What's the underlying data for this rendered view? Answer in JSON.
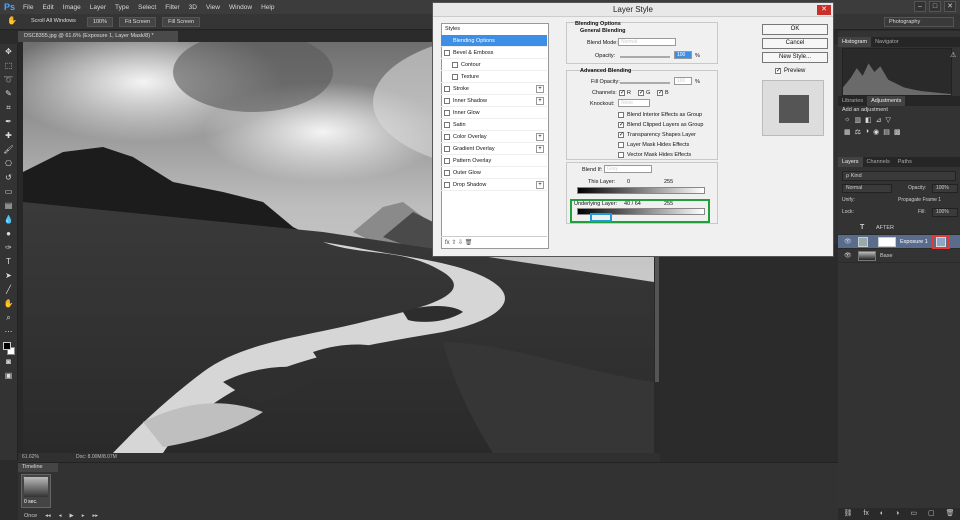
{
  "app": {
    "logo": "Ps",
    "menu": [
      "File",
      "Edit",
      "Image",
      "Layer",
      "Type",
      "Select",
      "Filter",
      "3D",
      "View",
      "Window",
      "Help"
    ],
    "window_controls": [
      "–",
      "□",
      "✕"
    ]
  },
  "options_bar": {
    "scroll_all": "Scroll All Windows",
    "zoom_100": "100%",
    "fit_screen": "Fit Screen",
    "fill_screen": "Fill Screen",
    "workspace": "Photography"
  },
  "document": {
    "tab_title": "DSC8355.jpg @ 61.6% (Exposure 1, Layer Mask/8) *",
    "zoom": "61.62%",
    "doc_size": "Doc: 8.00M/8.07M"
  },
  "timeline": {
    "label": "Timeline",
    "frame_number": "1",
    "frame_duration": "0 sec.",
    "loop": "Once",
    "controls": [
      "◂◂",
      "◂",
      "▶",
      "▸",
      "▸▸"
    ]
  },
  "dialog": {
    "title": "Layer Style",
    "close_glyph": "✕",
    "styles_header": "Styles",
    "styles": [
      {
        "label": "Blending Options",
        "selected": true,
        "checkbox": false,
        "plus": false,
        "sub": false
      },
      {
        "label": "Bevel & Emboss",
        "checkbox": true,
        "plus": false,
        "sub": false
      },
      {
        "label": "Contour",
        "checkbox": true,
        "plus": false,
        "sub": true
      },
      {
        "label": "Texture",
        "checkbox": true,
        "plus": false,
        "sub": true
      },
      {
        "label": "Stroke",
        "checkbox": true,
        "plus": true,
        "sub": false
      },
      {
        "label": "Inner Shadow",
        "checkbox": true,
        "plus": true,
        "sub": false
      },
      {
        "label": "Inner Glow",
        "checkbox": true,
        "plus": false,
        "sub": false
      },
      {
        "label": "Satin",
        "checkbox": true,
        "plus": false,
        "sub": false
      },
      {
        "label": "Color Overlay",
        "checkbox": true,
        "plus": true,
        "sub": false
      },
      {
        "label": "Gradient Overlay",
        "checkbox": true,
        "plus": true,
        "sub": false
      },
      {
        "label": "Pattern Overlay",
        "checkbox": true,
        "plus": false,
        "sub": false
      },
      {
        "label": "Outer Glow",
        "checkbox": true,
        "plus": false,
        "sub": false
      },
      {
        "label": "Drop Shadow",
        "checkbox": true,
        "plus": true,
        "sub": false
      }
    ],
    "styles_footer": "fx  ⇧  ⇩       🗑",
    "blending_options_title": "Blending Options",
    "general_blending": "General Blending",
    "blend_mode_label": "Blend Mode:",
    "blend_mode_value": "Normal",
    "opacity_label": "Opacity:",
    "opacity_value": "100",
    "percent": "%",
    "advanced_blending": "Advanced Blending",
    "fill_opacity_label": "Fill Opacity:",
    "fill_opacity_value": "100",
    "channels_label": "Channels:",
    "channels": [
      "R",
      "G",
      "B"
    ],
    "knockout_label": "Knockout:",
    "knockout_value": "None",
    "options": [
      {
        "label": "Blend Interior Effects as Group",
        "checked": false
      },
      {
        "label": "Blend Clipped Layers as Group",
        "checked": true
      },
      {
        "label": "Transparency Shapes Layer",
        "checked": true
      },
      {
        "label": "Layer Mask Hides Effects",
        "checked": false
      },
      {
        "label": "Vector Mask Hides Effects",
        "checked": false
      }
    ],
    "blend_if_label": "Blend If:",
    "blend_if_value": "Gray",
    "this_layer_label": "This Layer:",
    "this_layer_low": "0",
    "this_layer_high": "255",
    "underlying_label": "Underlying Layer:",
    "underlying_values": "40  /  64",
    "underlying_high": "255",
    "buttons": {
      "ok": "OK",
      "cancel": "Cancel",
      "new_style": "New Style...",
      "preview": "Preview"
    },
    "check_glyph": "✓"
  },
  "panels": {
    "histogram_tabs": [
      "Histogram",
      "Navigator"
    ],
    "histogram_warning": "⚠",
    "adjustments_tabs": [
      "Libraries",
      "Adjustments"
    ],
    "add_adjustment": "Add an adjustment",
    "adj_row1": [
      "☼",
      "▥",
      "◧",
      "⊿",
      "▽"
    ],
    "adj_row2": [
      "▦",
      "⚖",
      "◑",
      "◉",
      "▤",
      "▩"
    ],
    "layers_tabs": [
      "Layers",
      "Channels",
      "Paths"
    ],
    "filter_kind": "ρ Kind",
    "blend_mode": "Normal",
    "opacity_label": "Opacity:",
    "opacity_value": "100%",
    "unify_label": "Unify:",
    "propagate": "Propagate Frame 1",
    "lock_label": "Lock:",
    "fill_label": "Fill:",
    "fill_value": "100%",
    "layers": [
      {
        "name": "AFTER",
        "type": "text"
      },
      {
        "name": "Exposure 1",
        "type": "adjustment",
        "selected": true
      },
      {
        "name": "Base",
        "type": "image"
      }
    ],
    "bottom_icons": [
      "⛓",
      "fx",
      "◐",
      "◑",
      "▭",
      "▢",
      "🗑"
    ]
  },
  "colors": {
    "selection_blue": "#3d8fe6",
    "annotation_green": "#1fa03a",
    "annotation_blue": "#1e9bd7",
    "annotation_red": "#e53935"
  }
}
